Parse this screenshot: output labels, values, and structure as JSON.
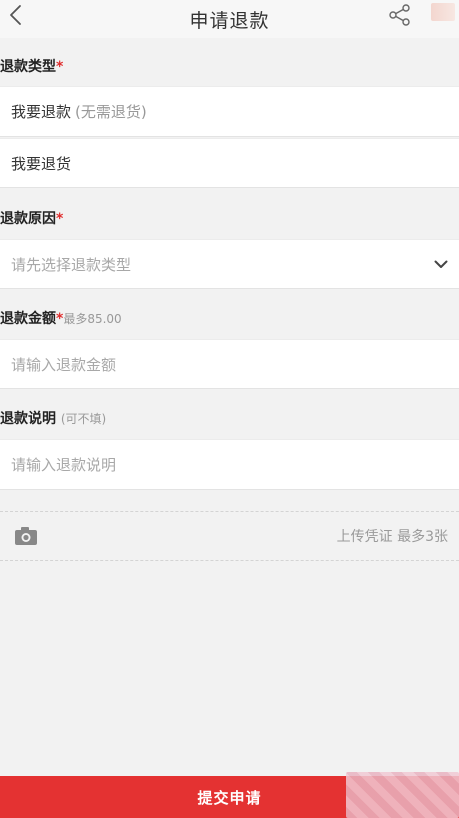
{
  "header": {
    "title": "申请退款"
  },
  "refund_type": {
    "label": "退款类型",
    "required_mark": "*",
    "options": [
      {
        "main": "我要退款",
        "sub": "(无需退货)"
      },
      {
        "main": "我要退货",
        "sub": ""
      }
    ]
  },
  "refund_reason": {
    "label": "退款原因",
    "required_mark": "*",
    "placeholder": "请先选择退款类型"
  },
  "refund_amount": {
    "label": "退款金额",
    "required_mark": "*",
    "hint": "最多85.00",
    "placeholder": "请输入退款金额"
  },
  "refund_note": {
    "label": "退款说明",
    "hint": "(可不填)",
    "placeholder": "请输入退款说明"
  },
  "upload": {
    "text": "上传凭证 最多3张"
  },
  "submit": {
    "label": "提交申请"
  },
  "icons": {
    "back": "chevron-left-icon",
    "share": "share-icon",
    "dropdown": "chevron-down-icon",
    "camera": "camera-icon"
  },
  "colors": {
    "accent": "#e43232",
    "required": "#e02c2c",
    "placeholder": "#a8a8a8",
    "background": "#f2f2f2"
  }
}
